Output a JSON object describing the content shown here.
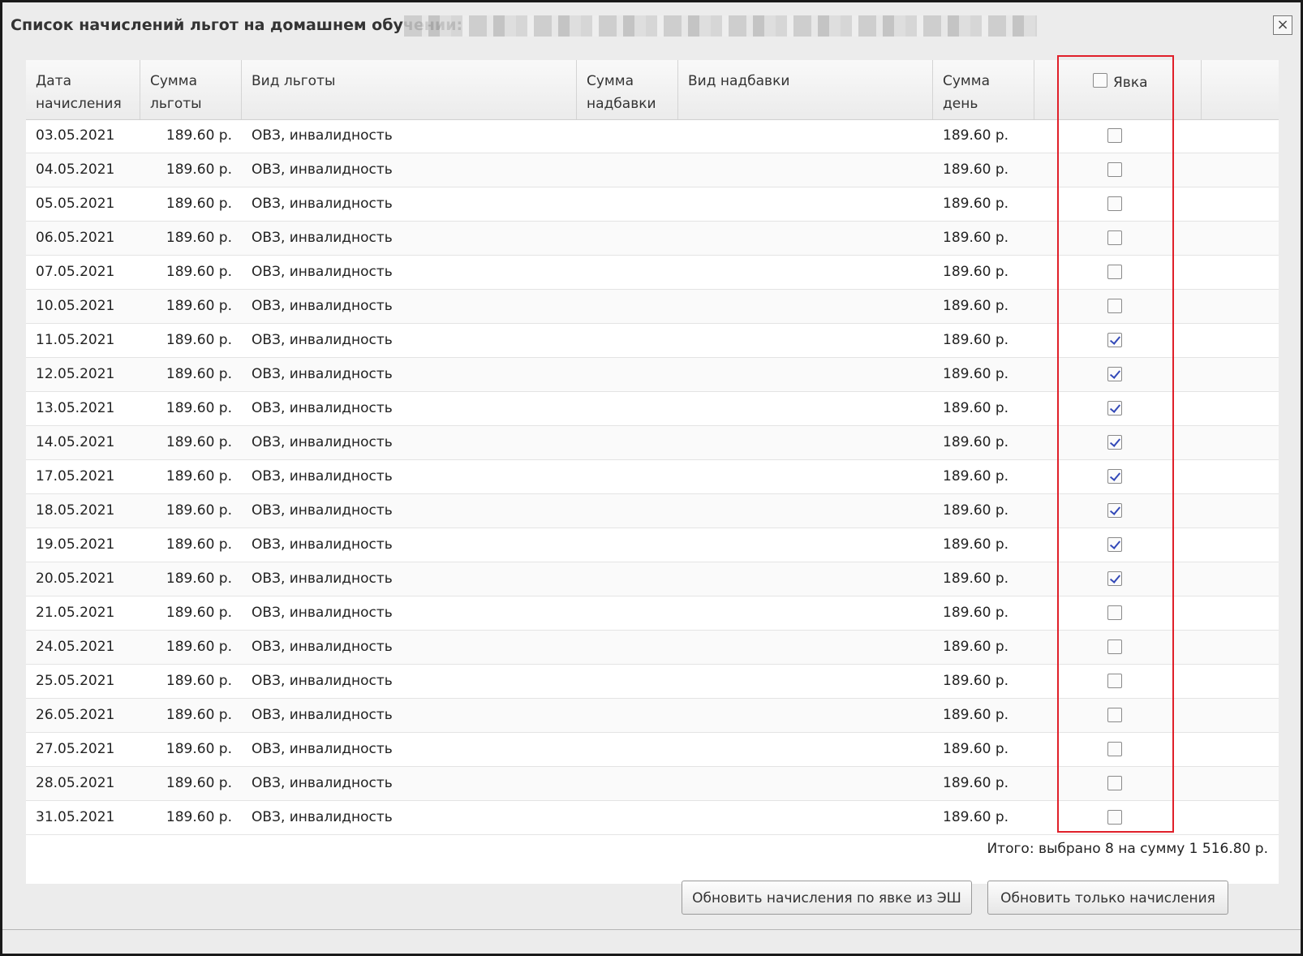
{
  "dialog": {
    "title": "Список начислений льгот на домашнем обучении:",
    "close_label": "×"
  },
  "table": {
    "headers": {
      "date": [
        "Дата",
        "начисления"
      ],
      "sum_benefit": [
        "Сумма",
        "льготы"
      ],
      "benefit_type": [
        "Вид льготы"
      ],
      "sum_bonus": [
        "Сумма",
        "надбавки"
      ],
      "bonus_type": [
        "Вид надбавки"
      ],
      "sum_day": [
        "Сумма",
        "день"
      ],
      "attendance": "Явка"
    },
    "header_attendance_checked": false,
    "rows": [
      {
        "date": "03.05.2021",
        "sum": "189.60 р.",
        "type": "ОВЗ, инвалидность",
        "bonus_sum": "",
        "bonus_type": "",
        "day_sum": "189.60 р.",
        "checked": false
      },
      {
        "date": "04.05.2021",
        "sum": "189.60 р.",
        "type": "ОВЗ, инвалидность",
        "bonus_sum": "",
        "bonus_type": "",
        "day_sum": "189.60 р.",
        "checked": false
      },
      {
        "date": "05.05.2021",
        "sum": "189.60 р.",
        "type": "ОВЗ, инвалидность",
        "bonus_sum": "",
        "bonus_type": "",
        "day_sum": "189.60 р.",
        "checked": false
      },
      {
        "date": "06.05.2021",
        "sum": "189.60 р.",
        "type": "ОВЗ, инвалидность",
        "bonus_sum": "",
        "bonus_type": "",
        "day_sum": "189.60 р.",
        "checked": false
      },
      {
        "date": "07.05.2021",
        "sum": "189.60 р.",
        "type": "ОВЗ, инвалидность",
        "bonus_sum": "",
        "bonus_type": "",
        "day_sum": "189.60 р.",
        "checked": false
      },
      {
        "date": "10.05.2021",
        "sum": "189.60 р.",
        "type": "ОВЗ, инвалидность",
        "bonus_sum": "",
        "bonus_type": "",
        "day_sum": "189.60 р.",
        "checked": false
      },
      {
        "date": "11.05.2021",
        "sum": "189.60 р.",
        "type": "ОВЗ, инвалидность",
        "bonus_sum": "",
        "bonus_type": "",
        "day_sum": "189.60 р.",
        "checked": true
      },
      {
        "date": "12.05.2021",
        "sum": "189.60 р.",
        "type": "ОВЗ, инвалидность",
        "bonus_sum": "",
        "bonus_type": "",
        "day_sum": "189.60 р.",
        "checked": true
      },
      {
        "date": "13.05.2021",
        "sum": "189.60 р.",
        "type": "ОВЗ, инвалидность",
        "bonus_sum": "",
        "bonus_type": "",
        "day_sum": "189.60 р.",
        "checked": true
      },
      {
        "date": "14.05.2021",
        "sum": "189.60 р.",
        "type": "ОВЗ, инвалидность",
        "bonus_sum": "",
        "bonus_type": "",
        "day_sum": "189.60 р.",
        "checked": true
      },
      {
        "date": "17.05.2021",
        "sum": "189.60 р.",
        "type": "ОВЗ, инвалидность",
        "bonus_sum": "",
        "bonus_type": "",
        "day_sum": "189.60 р.",
        "checked": true
      },
      {
        "date": "18.05.2021",
        "sum": "189.60 р.",
        "type": "ОВЗ, инвалидность",
        "bonus_sum": "",
        "bonus_type": "",
        "day_sum": "189.60 р.",
        "checked": true
      },
      {
        "date": "19.05.2021",
        "sum": "189.60 р.",
        "type": "ОВЗ, инвалидность",
        "bonus_sum": "",
        "bonus_type": "",
        "day_sum": "189.60 р.",
        "checked": true
      },
      {
        "date": "20.05.2021",
        "sum": "189.60 р.",
        "type": "ОВЗ, инвалидность",
        "bonus_sum": "",
        "bonus_type": "",
        "day_sum": "189.60 р.",
        "checked": true
      },
      {
        "date": "21.05.2021",
        "sum": "189.60 р.",
        "type": "ОВЗ, инвалидность",
        "bonus_sum": "",
        "bonus_type": "",
        "day_sum": "189.60 р.",
        "checked": false
      },
      {
        "date": "24.05.2021",
        "sum": "189.60 р.",
        "type": "ОВЗ, инвалидность",
        "bonus_sum": "",
        "bonus_type": "",
        "day_sum": "189.60 р.",
        "checked": false
      },
      {
        "date": "25.05.2021",
        "sum": "189.60 р.",
        "type": "ОВЗ, инвалидность",
        "bonus_sum": "",
        "bonus_type": "",
        "day_sum": "189.60 р.",
        "checked": false
      },
      {
        "date": "26.05.2021",
        "sum": "189.60 р.",
        "type": "ОВЗ, инвалидность",
        "bonus_sum": "",
        "bonus_type": "",
        "day_sum": "189.60 р.",
        "checked": false
      },
      {
        "date": "27.05.2021",
        "sum": "189.60 р.",
        "type": "ОВЗ, инвалидность",
        "bonus_sum": "",
        "bonus_type": "",
        "day_sum": "189.60 р.",
        "checked": false
      },
      {
        "date": "28.05.2021",
        "sum": "189.60 р.",
        "type": "ОВЗ, инвалидность",
        "bonus_sum": "",
        "bonus_type": "",
        "day_sum": "189.60 р.",
        "checked": false
      },
      {
        "date": "31.05.2021",
        "sum": "189.60 р.",
        "type": "ОВЗ, инвалидность",
        "bonus_sum": "",
        "bonus_type": "",
        "day_sum": "189.60 р.",
        "checked": false
      }
    ],
    "totals": "Итого: выбрано 8 на сумму 1 516.80 р."
  },
  "buttons": {
    "update_by_attendance": "Обновить начисления по явке из ЭШ",
    "update_only": "Обновить только начисления"
  },
  "colors": {
    "highlight": "#e0202a",
    "check": "#3349b8"
  }
}
